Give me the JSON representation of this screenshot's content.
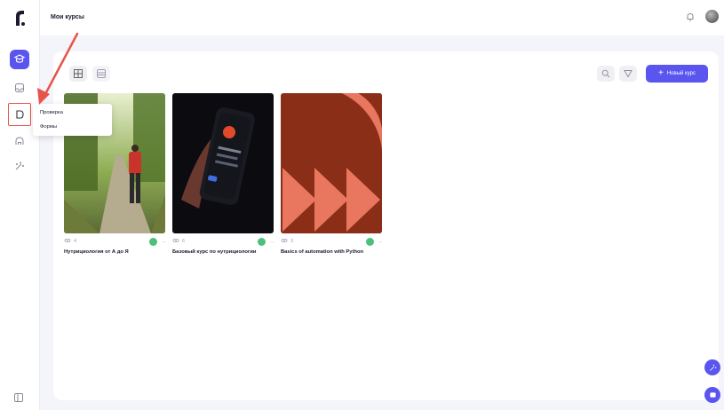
{
  "header": {
    "title": "Мои курсы"
  },
  "toolbar": {
    "new_course_label": "Новый курс"
  },
  "popup": {
    "items": [
      "Проверка",
      "Формы"
    ]
  },
  "courses": [
    {
      "members": "4",
      "title": "Нутрициология от А до Я"
    },
    {
      "members": "6",
      "title": "Базовый курс по нутрициологии"
    },
    {
      "members": "3",
      "title": "Basics of automation with Python"
    }
  ],
  "colors": {
    "accent": "#5b55f0",
    "annotation_red": "#e8544a",
    "status_green": "#4cc07a"
  },
  "icons": {
    "logo": "brand-logo",
    "sidebar": [
      "courses-icon",
      "inbox-icon",
      "review-icon",
      "home-icon",
      "magic-icon"
    ],
    "toolbar": [
      "grid-view-icon",
      "list-view-icon",
      "search-icon",
      "filter-icon"
    ]
  }
}
